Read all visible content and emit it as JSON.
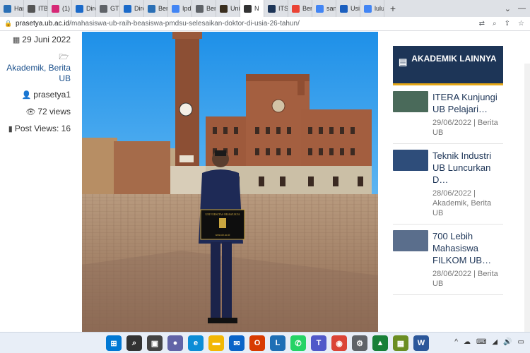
{
  "tabs": [
    {
      "label": "Hari",
      "color": "#2a6fb5"
    },
    {
      "label": "ITB (",
      "color": "#555"
    },
    {
      "label": "(1) I",
      "color": "#d62976"
    },
    {
      "label": "Dire",
      "color": "#1b6ac9"
    },
    {
      "label": "GTK",
      "color": "#5f6368"
    },
    {
      "label": "Dire",
      "color": "#1b6ac9"
    },
    {
      "label": "Berit",
      "color": "#2a6fb5"
    },
    {
      "label": "Ipdp",
      "color": "#4285f4"
    },
    {
      "label": "Bera",
      "color": "#5f6368"
    },
    {
      "label": "Univ",
      "color": "#3a2e1e"
    },
    {
      "label": "N",
      "color": "#333",
      "active": true
    },
    {
      "label": "ITS I",
      "color": "#1d3557"
    },
    {
      "label": "Berit",
      "color": "#ea4335"
    },
    {
      "label": "sam",
      "color": "#4285f4"
    },
    {
      "label": "Usia",
      "color": "#1b5fbf"
    },
    {
      "label": "lulus",
      "color": "#4285f4"
    }
  ],
  "browser": {
    "url_domain": "prasetya.ub.ac.id",
    "url_path": "/mahasiswa-ub-raih-beasiswa-pmdsu-selesaikan-doktor-di-usia-26-tahun/",
    "new_tab": "+"
  },
  "meta": {
    "date": "29 Juni 2022",
    "categories": "Akademik, Berita UB",
    "author": "prasetya1",
    "views": "72 views",
    "post_views": "Post Views: 16"
  },
  "sidebar": {
    "heading": "AKADEMIK LAINNYA",
    "items": [
      {
        "title": "ITERA Kunjungi UB Pelajari…",
        "meta": "29/06/2022 | Berita UB",
        "thumb": "#4a6a5a"
      },
      {
        "title": "Teknik Industri UB Luncurkan D…",
        "meta": "28/06/2022 | Akademik, Berita UB",
        "thumb": "#2e4d7a"
      },
      {
        "title": "700 Lebih Mahasiswa FILKOM UB…",
        "meta": "28/06/2022 | Berita UB",
        "thumb": "#5a6e8c"
      }
    ]
  },
  "photo": {
    "plaque_text": "UNIVERSITAS BRAWIJAYA",
    "plaque_sub": "www.ub.ac.id"
  },
  "taskbar": {
    "apps": [
      {
        "name": "start",
        "color": "#0078d4",
        "glyph": "⊞"
      },
      {
        "name": "search",
        "color": "#333",
        "glyph": "⌕"
      },
      {
        "name": "task-view",
        "color": "#444",
        "glyph": "▣"
      },
      {
        "name": "chat",
        "color": "#6264a7",
        "glyph": "●"
      },
      {
        "name": "edge",
        "color": "#0c8dd6",
        "glyph": "e"
      },
      {
        "name": "file-explorer",
        "color": "#f2b705",
        "glyph": "▬"
      },
      {
        "name": "mail",
        "color": "#0a64c8",
        "glyph": "✉"
      },
      {
        "name": "office",
        "color": "#d83b01",
        "glyph": "O"
      },
      {
        "name": "lexicon",
        "color": "#1e6fb5",
        "glyph": "L"
      },
      {
        "name": "whatsapp",
        "color": "#25d366",
        "glyph": "✆"
      },
      {
        "name": "teams",
        "color": "#5059c9",
        "glyph": "T"
      },
      {
        "name": "chrome",
        "color": "#db4437",
        "glyph": "◉"
      },
      {
        "name": "settings",
        "color": "#5f6368",
        "glyph": "⚙"
      },
      {
        "name": "drive",
        "color": "#188038",
        "glyph": "▲"
      },
      {
        "name": "photos",
        "color": "#6b8e23",
        "glyph": "▦"
      },
      {
        "name": "word",
        "color": "#2b579a",
        "glyph": "W"
      }
    ],
    "tray": [
      "^",
      "☁",
      "⌨",
      "◢",
      "🔊",
      "▭"
    ]
  }
}
